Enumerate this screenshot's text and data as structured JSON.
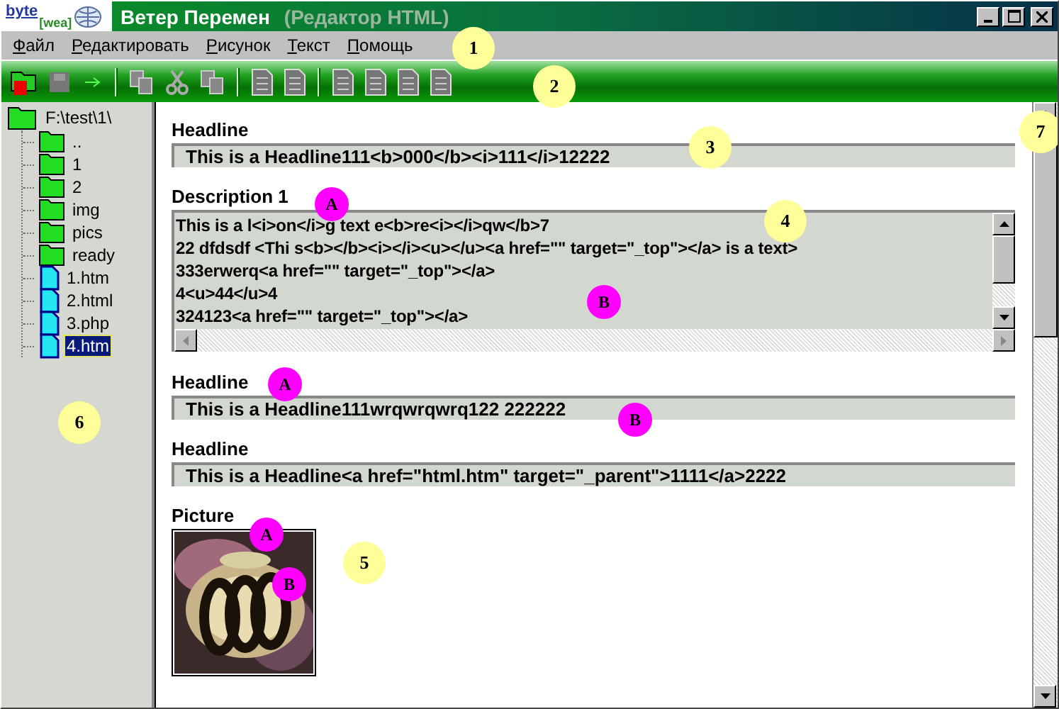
{
  "window": {
    "logo_top": "byte",
    "logo_bottom": "[wea]",
    "title": "Ветер Перемен",
    "subtitle": "(Редактор HTML)"
  },
  "menu": [
    "Файл",
    "Редактировать",
    "Рисунок",
    "Текст",
    "Помощь"
  ],
  "tree": {
    "label": "F:\\test\\1\\",
    "kind": "folder",
    "children": [
      {
        "label": "..",
        "kind": "folder",
        "selected": false
      },
      {
        "label": "1",
        "kind": "folder",
        "selected": false
      },
      {
        "label": "2",
        "kind": "folder",
        "selected": false
      },
      {
        "label": "img",
        "kind": "folder",
        "selected": false
      },
      {
        "label": "pics",
        "kind": "folder",
        "selected": false
      },
      {
        "label": "ready",
        "kind": "folder",
        "selected": false
      },
      {
        "label": "1.htm",
        "kind": "file",
        "selected": false
      },
      {
        "label": "2.html",
        "kind": "file",
        "selected": false
      },
      {
        "label": "3.php",
        "kind": "file",
        "selected": false
      },
      {
        "label": "4.htm",
        "kind": "file",
        "selected": true
      }
    ]
  },
  "fields": [
    {
      "kind": "line",
      "label": "Headline",
      "value": "This is a Headline111<b>000</b><i>111</i>12222"
    },
    {
      "kind": "area",
      "label": "Description 1",
      "lines": [
        "This is a l<i>on</i>g text e<b>re<i></i>qw</b>7",
        "22 dfdsdf <Thi s<b></b><i></i><u></u><a href=\"\" target=\"_top\"></a> is a  text>",
        "333erwerq<a href=\"\" target=\"_top\"></a>",
        "4<u>44</u>4",
        "324123<a href=\"\" target=\"_top\"></a>"
      ]
    },
    {
      "kind": "line",
      "label": "Headline",
      "value": "This is a Headline111wrqwrqwrq122 222222"
    },
    {
      "kind": "line",
      "label": "Headline",
      "value": "This is a Headline<a href=\"html.htm\" target=\"_parent\">1111</a>2222"
    },
    {
      "kind": "picture",
      "label": "Picture"
    }
  ],
  "callouts": [
    {
      "text": "1",
      "kind": "number"
    },
    {
      "text": "2",
      "kind": "number"
    },
    {
      "text": "3",
      "kind": "number"
    },
    {
      "text": "4",
      "kind": "number"
    },
    {
      "text": "7",
      "kind": "number"
    },
    {
      "text": "6",
      "kind": "number"
    },
    {
      "text": "5",
      "kind": "number"
    },
    {
      "text": "A",
      "kind": "letter"
    },
    {
      "text": "B",
      "kind": "letter"
    },
    {
      "text": "A",
      "kind": "letter"
    },
    {
      "text": "B",
      "kind": "letter"
    },
    {
      "text": "A",
      "kind": "letter"
    },
    {
      "text": "B",
      "kind": "letter"
    }
  ]
}
